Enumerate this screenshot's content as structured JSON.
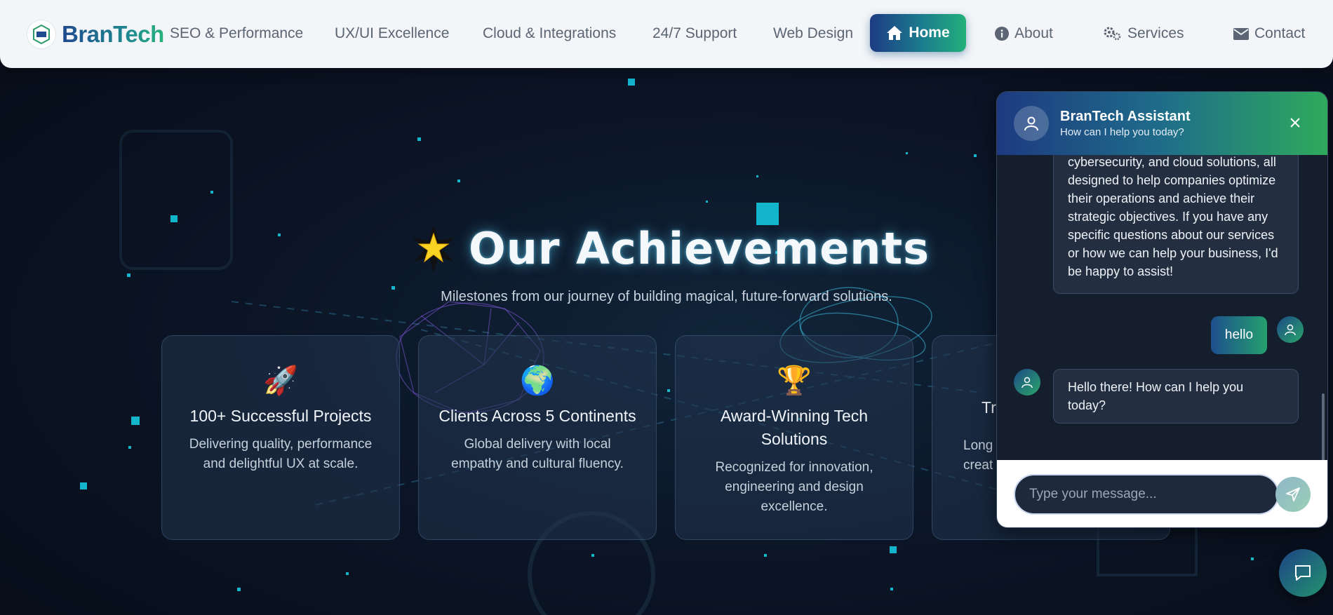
{
  "brand": {
    "name": "BranTech"
  },
  "nav": {
    "links": [
      "SEO & Performance",
      "UX/UI Excellence",
      "Cloud & Integrations",
      "24/7 Support",
      "Web Design"
    ],
    "home": "Home",
    "about": "About",
    "services": "Services",
    "contact": "Contact"
  },
  "hero": {
    "title": "Our Achievements",
    "subtitle": "Milestones from our journey of building magical, future-forward solutions."
  },
  "cards": [
    {
      "emoji": "🚀",
      "title": "100+ Successful Projects",
      "desc": "Delivering quality, performance and delightful UX at scale."
    },
    {
      "emoji": "🌍",
      "title": "Clients Across 5 Continents",
      "desc": "Global delivery with local empathy and cultural fluency."
    },
    {
      "emoji": "🏆",
      "title": "Award-Winning Tech Solutions",
      "desc": "Recognized for innovation, engineering and design excellence."
    },
    {
      "emoji": "",
      "title": "Tr",
      "desc": "Long creat"
    }
  ],
  "chat": {
    "title": "BranTech Assistant",
    "subtitle": "How can I help you today?",
    "messages": [
      {
        "from": "bot",
        "text": "cybersecurity, and cloud solutions, all designed to help companies optimize their operations and achieve their strategic objectives. If you have any specific questions about our services or how we can help your business, I'd be happy to assist!"
      },
      {
        "from": "user",
        "text": "hello"
      },
      {
        "from": "bot",
        "text": "Hello there! How can I help you today?"
      }
    ],
    "input_placeholder": "Type your message..."
  },
  "colors": {
    "accent_blue": "#1d3b84",
    "accent_green": "#22b07a",
    "star": "#12b5cc"
  }
}
